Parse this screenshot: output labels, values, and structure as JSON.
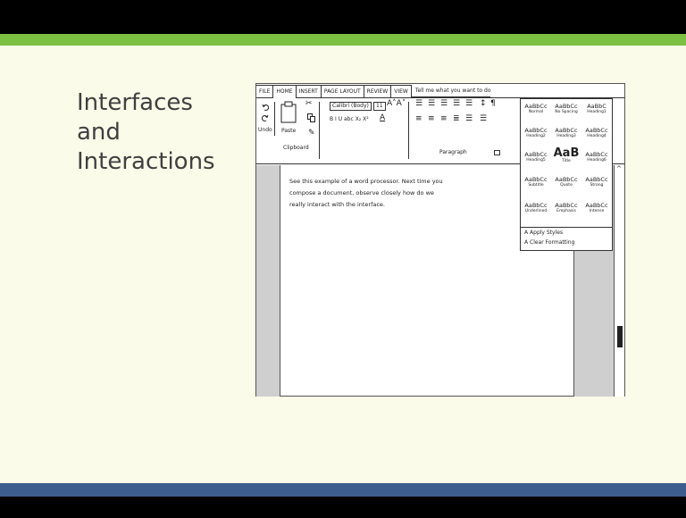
{
  "slide": {
    "title": "Interfaces\nand\nInteractions",
    "colors": {
      "accent_green": "#7dc143",
      "accent_blue": "#3d5d8e",
      "background": "#fafbe8"
    }
  },
  "sketch": {
    "menu_tabs": [
      "FILE",
      "HOME",
      "INSERT",
      "PAGE LAYOUT",
      "REVIEW",
      "VIEW"
    ],
    "tell_me": "Tell me what you want to do",
    "ribbon": {
      "undo_icon": "undo-arrow-icon",
      "redo_icon": "redo-arrow-icon",
      "undo_label": "Undo",
      "paste_label": "Paste",
      "clipboard_label": "Clipboard",
      "font_name": "Calibri (Body)",
      "font_size": "11",
      "grow_font": "A˄A˅",
      "format_row": "B I U abc X₂ X²",
      "highlight": "A",
      "paragraph_label": "Paragraph",
      "pilcrow": "¶"
    },
    "styles": [
      {
        "sample": "AaBbCc",
        "name": "Normal"
      },
      {
        "sample": "AaBbCc",
        "name": "No Spacing"
      },
      {
        "sample": "AaBbC",
        "name": "Heading1"
      },
      {
        "sample": "AaBbCc",
        "name": "Heading2"
      },
      {
        "sample": "AaBbCc",
        "name": "Heading3"
      },
      {
        "sample": "AaBbCc",
        "name": "Heading4"
      },
      {
        "sample": "AaBbCc",
        "name": "Heading5"
      },
      {
        "sample": "AaB",
        "name": "Title"
      },
      {
        "sample": "AaBbCc",
        "name": "Heading6"
      },
      {
        "sample": "AaBbCc",
        "name": "Subtitle"
      },
      {
        "sample": "AaBbCc",
        "name": "Quote"
      },
      {
        "sample": "AaBbCc",
        "name": "Strong"
      },
      {
        "sample": "AaBbCc",
        "name": "Underlined"
      },
      {
        "sample": "AaBbCc",
        "name": "Emphasis"
      },
      {
        "sample": "AaBbCc",
        "name": "Intense"
      }
    ],
    "apply_styles": "Apply Styles",
    "clear_formatting": "Clear Formatting",
    "document_text": "See this example of a word processor. Next time you\ncompose a document, observe closely how do we\nreally interact with the interface."
  }
}
